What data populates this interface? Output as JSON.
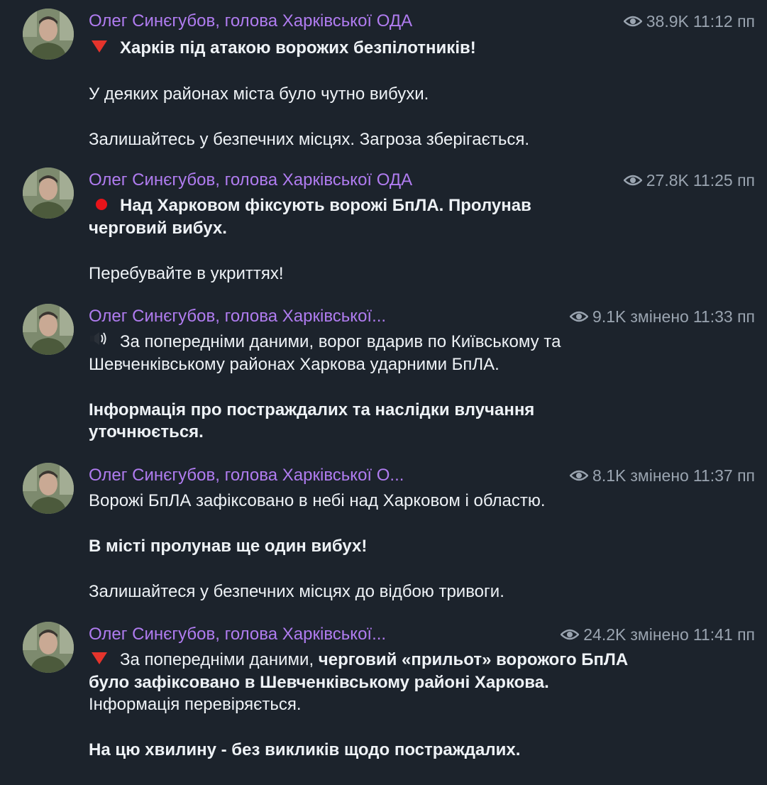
{
  "messages": [
    {
      "author": "Олег Синєгубов, голова Харківської ОДА",
      "views": "38.9K",
      "edited": "",
      "time": "11:12 пп",
      "emoji_icon": "red-triangle-down-icon",
      "lines": {
        "l1": "Харків під атакою ворожих безпілотників!",
        "l2": "У деяких районах міста було чутно вибухи.",
        "l3": "Залишайтесь у безпечних місцях. Загроза зберігається."
      }
    },
    {
      "author": "Олег Синєгубов, голова Харківської ОДА",
      "views": "27.8K",
      "edited": "",
      "time": "11:25 пп",
      "emoji_icon": "red-circle-icon",
      "lines": {
        "l1": "Над Харковом фіксують ворожі БпЛА. Пролунав черговий вибух.",
        "l2": "Перебувайте в укриттях!"
      }
    },
    {
      "author": "Олег Синєгубов, голова Харківської...",
      "views": "9.1K",
      "edited": "змінено",
      "time": "11:33 пп",
      "emoji_icon": "loudspeaker-icon",
      "lines": {
        "l1": "За попередніми даними, ворог вдарив по Київському та Шевченківському районах Харкова ударними БпЛА.",
        "l2": "Інформація про постраждалих та наслідки влучання уточнюється."
      }
    },
    {
      "author": "Олег Синєгубов, голова Харківської О...",
      "views": "8.1K",
      "edited": "змінено",
      "time": "11:37 пп",
      "lines": {
        "l1": "Ворожі БпЛА зафіксовано в небі над Харковом і областю.",
        "l2": "В місті пролунав ще один вибух!",
        "l3": "Залишайтеся у безпечних місцях до відбою тривоги."
      }
    },
    {
      "author": "Олег Синєгубов, голова Харківської...",
      "views": "24.2K",
      "edited": "змінено",
      "time": "11:41 пп",
      "emoji_icon": "red-triangle-down-icon",
      "lines": {
        "l1a": "За попередніми даними, ",
        "l1b": "черговий «прильот» ворожого БпЛА було зафіксовано в Шевченківському районі Харкова.",
        "l2": "Інформація перевіряється.",
        "l3": "На цю хвилину - без викликів щодо постраждалих."
      }
    }
  ],
  "colors": {
    "background": "#1c232c",
    "author": "#b07cf0",
    "meta": "#9aa4b0",
    "text": "#eef2f6"
  }
}
